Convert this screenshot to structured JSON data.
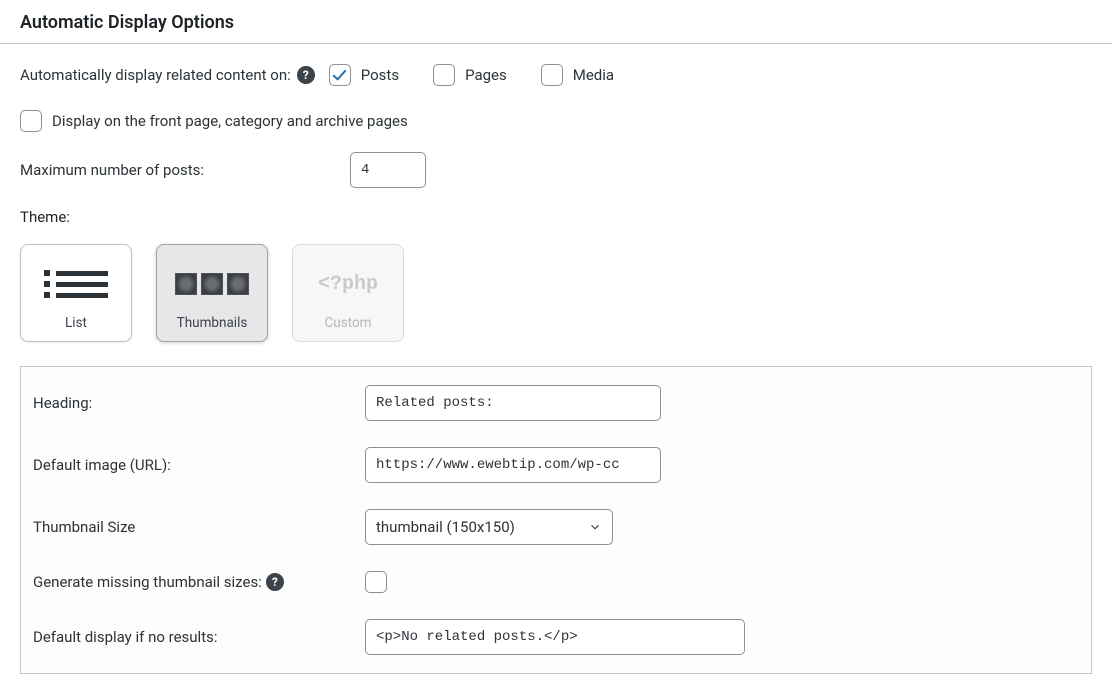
{
  "section_title": "Automatic Display Options",
  "auto_display_label": "Automatically display related content on:",
  "checkboxes": {
    "posts": {
      "label": "Posts",
      "checked": true
    },
    "pages": {
      "label": "Pages",
      "checked": false
    },
    "media": {
      "label": "Media",
      "checked": false
    }
  },
  "front_page": {
    "label": "Display on the front page, category and archive pages",
    "checked": false
  },
  "max_posts": {
    "label": "Maximum number of posts:",
    "value": "4"
  },
  "theme": {
    "label": "Theme:",
    "list": "List",
    "thumbnails": "Thumbnails",
    "custom": "Custom",
    "php": "<?php"
  },
  "panel": {
    "heading": {
      "label": "Heading:",
      "value": "Related posts:"
    },
    "default_image": {
      "label": "Default image (URL):",
      "value": "https://www.ewebtip.com/wp-cc"
    },
    "thumb_size": {
      "label": "Thumbnail Size",
      "value": "thumbnail (150x150)"
    },
    "gen_missing": {
      "label": "Generate missing thumbnail sizes:",
      "checked": false
    },
    "no_results": {
      "label": "Default display if no results:",
      "value": "<p>No related posts.</p>"
    }
  }
}
